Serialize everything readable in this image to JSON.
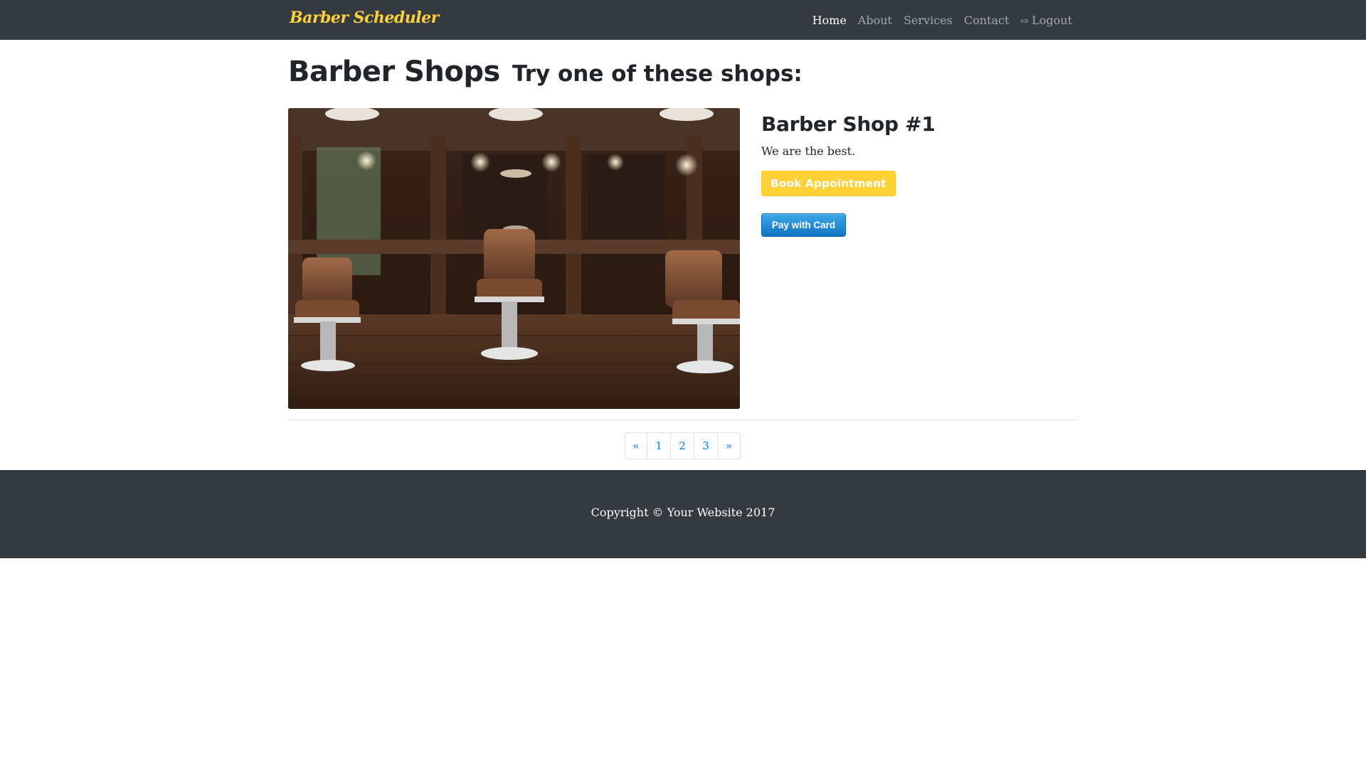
{
  "navbar": {
    "brand": "Barber Scheduler",
    "links": [
      {
        "label": "Home",
        "active": true
      },
      {
        "label": "About",
        "active": false
      },
      {
        "label": "Services",
        "active": false
      },
      {
        "label": "Contact",
        "active": false
      }
    ],
    "logout": {
      "icon": "sign-out-icon",
      "label": "Logout"
    }
  },
  "heading": {
    "title": "Barber Shops",
    "subtitle": "Try one of these shops:"
  },
  "shop": {
    "image": "barber-shop-interior-photo",
    "name": "Barber Shop #1",
    "description": "We are the best.",
    "book_label": "Book Appointment",
    "pay_label": "Pay with Card"
  },
  "pagination": {
    "prev": "«",
    "pages": [
      "1",
      "2",
      "3"
    ],
    "next": "»"
  },
  "footer": {
    "copyright": "Copyright © Your Website 2017"
  },
  "colors": {
    "navbar_bg": "#343a40",
    "brand": "#fed136",
    "link": "#007bff",
    "pay_button": "#1174c3"
  }
}
